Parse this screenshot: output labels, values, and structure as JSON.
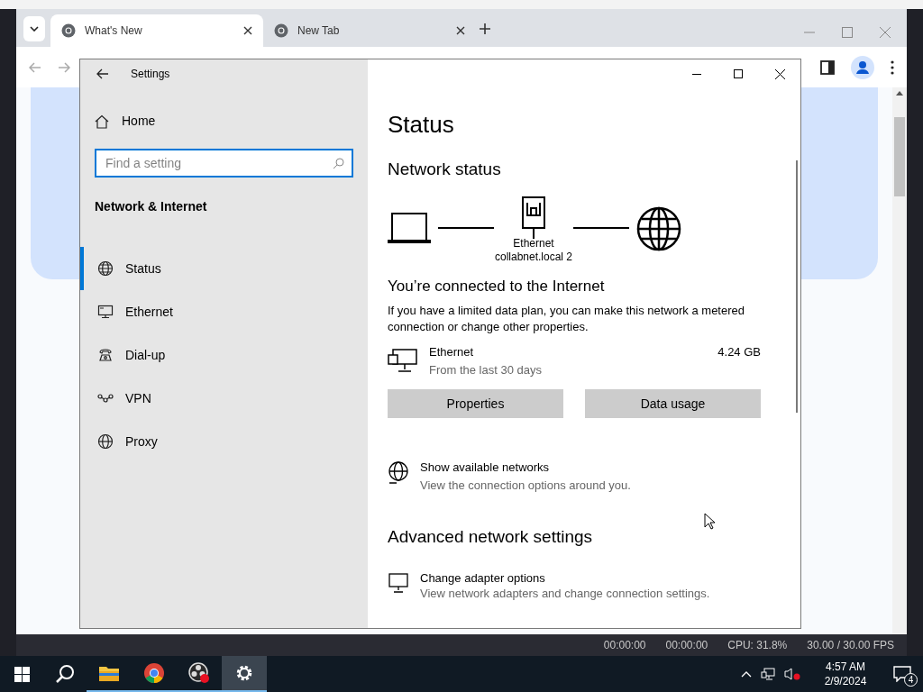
{
  "browser": {
    "tabs": [
      {
        "title": "What's New",
        "selected": true
      },
      {
        "title": "New Tab",
        "selected": false
      }
    ]
  },
  "settings": {
    "title": "Settings",
    "home": "Home",
    "search": {
      "placeholder": "Find a setting"
    },
    "section": "Network & Internet",
    "nav": [
      {
        "label": "Status",
        "kind": "status",
        "selected": true
      },
      {
        "label": "Ethernet",
        "kind": "ethernet",
        "selected": false
      },
      {
        "label": "Dial-up",
        "kind": "dialup",
        "selected": false
      },
      {
        "label": "VPN",
        "kind": "vpn",
        "selected": false
      },
      {
        "label": "Proxy",
        "kind": "proxy",
        "selected": false
      }
    ],
    "page": {
      "title": "Status",
      "network_status": "Network status",
      "adapter_label": "Ethernet",
      "network_name": "collabnet.local 2",
      "connected": "You’re connected to the Internet",
      "description": "If you have a limited data plan, you can make this network a metered connection or change other properties.",
      "usage": {
        "name": "Ethernet",
        "detail": "From the last 30 days",
        "amount": "4.24 GB"
      },
      "buttons": [
        "Properties",
        "Data usage"
      ],
      "links": [
        {
          "title": "Show available networks",
          "detail": "View the connection options around you."
        }
      ],
      "advanced": "Advanced network settings",
      "advanced_items": [
        {
          "title": "Change adapter options",
          "detail": "View network adapters and change connection settings."
        }
      ]
    }
  },
  "obs_status": [
    "00:00:00",
    "00:00:00",
    "CPU: 31.8%",
    "30.00 / 30.00 FPS"
  ],
  "taskbar": {
    "apps": [
      {
        "kind": "explorer",
        "running": true,
        "selected": false
      },
      {
        "kind": "chrome",
        "running": true,
        "selected": false
      },
      {
        "kind": "obs",
        "running": true,
        "selected": false
      },
      {
        "kind": "settings",
        "running": true,
        "selected": true
      }
    ],
    "time": "4:57 AM",
    "date": "2/9/2024",
    "notifications": "4"
  }
}
